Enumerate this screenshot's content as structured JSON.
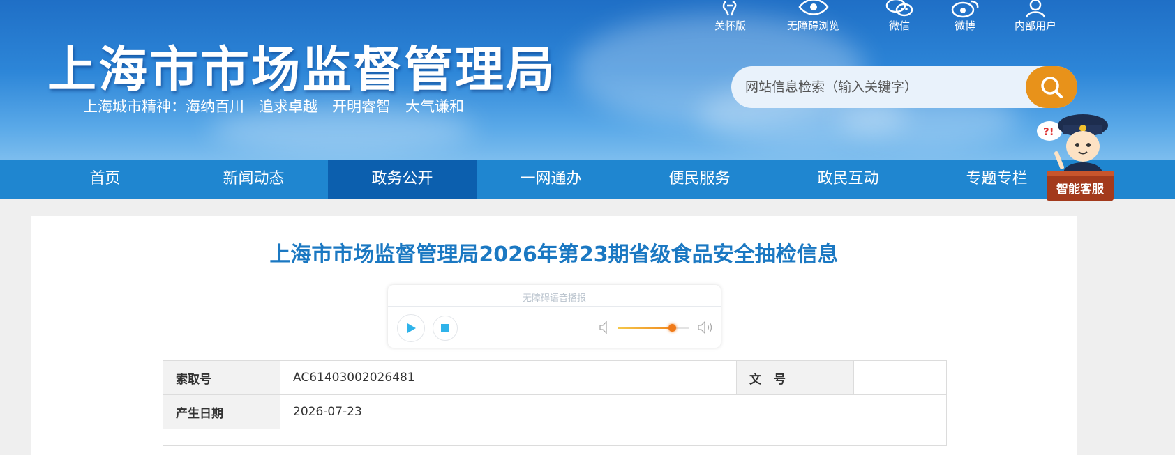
{
  "header": {
    "site_title": "上海市市场监督管理局",
    "slogan": "上海城市精神：海纳百川　追求卓越　开明睿智　大气谦和",
    "tools": [
      {
        "label": "关怀版",
        "icon": "care-icon"
      },
      {
        "label": "无障碍浏览",
        "icon": "eye-icon"
      },
      {
        "label": "微信",
        "icon": "wechat-icon"
      },
      {
        "label": "微博",
        "icon": "weibo-icon"
      },
      {
        "label": "内部用户",
        "icon": "user-icon"
      }
    ],
    "search": {
      "placeholder": "网站信息检索（输入关键字）"
    }
  },
  "nav": {
    "items": [
      "首页",
      "新闻动态",
      "政务公开",
      "一网通办",
      "便民服务",
      "政民互动",
      "专题专栏"
    ],
    "active": "政务公开"
  },
  "mascot": {
    "label": "智能客服"
  },
  "article": {
    "title": "上海市市场监督管理局2026年第23期省级食品安全抽检信息",
    "player": {
      "label": "无障碍语音播报",
      "volume": 0.76
    },
    "meta": {
      "index_label": "索取号",
      "index_value": "AC61403002026481",
      "doc_no_label": "文号",
      "doc_no_value": "",
      "date_label": "产生日期",
      "date_value": "2026-07-23"
    }
  },
  "colors": {
    "header_blue": "#2d86d8",
    "nav_blue": "#1f86d0",
    "nav_active": "#0c5fae",
    "search_orange": "#e8921a",
    "title_blue": "#1b78c2"
  }
}
